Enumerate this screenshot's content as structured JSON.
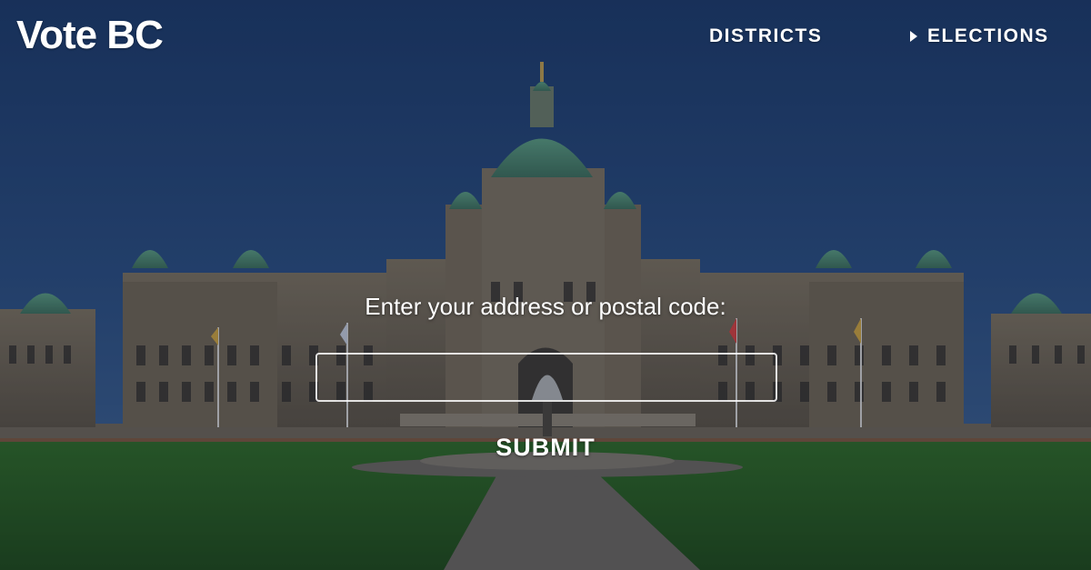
{
  "brand": {
    "title": "Vote BC"
  },
  "nav": {
    "districts_label": "DISTRICTS",
    "elections_label": "ELECTIONS"
  },
  "search": {
    "prompt": "Enter your address or postal code:",
    "value": "",
    "placeholder": "",
    "submit_label": "SUBMIT"
  },
  "background": {
    "description_icon": "legislature-building-photo",
    "sky_color": "#1f3e6e",
    "lawn_color": "#2a5a23",
    "stone_color": "#6b6254",
    "dome_color": "#4e8a74"
  }
}
